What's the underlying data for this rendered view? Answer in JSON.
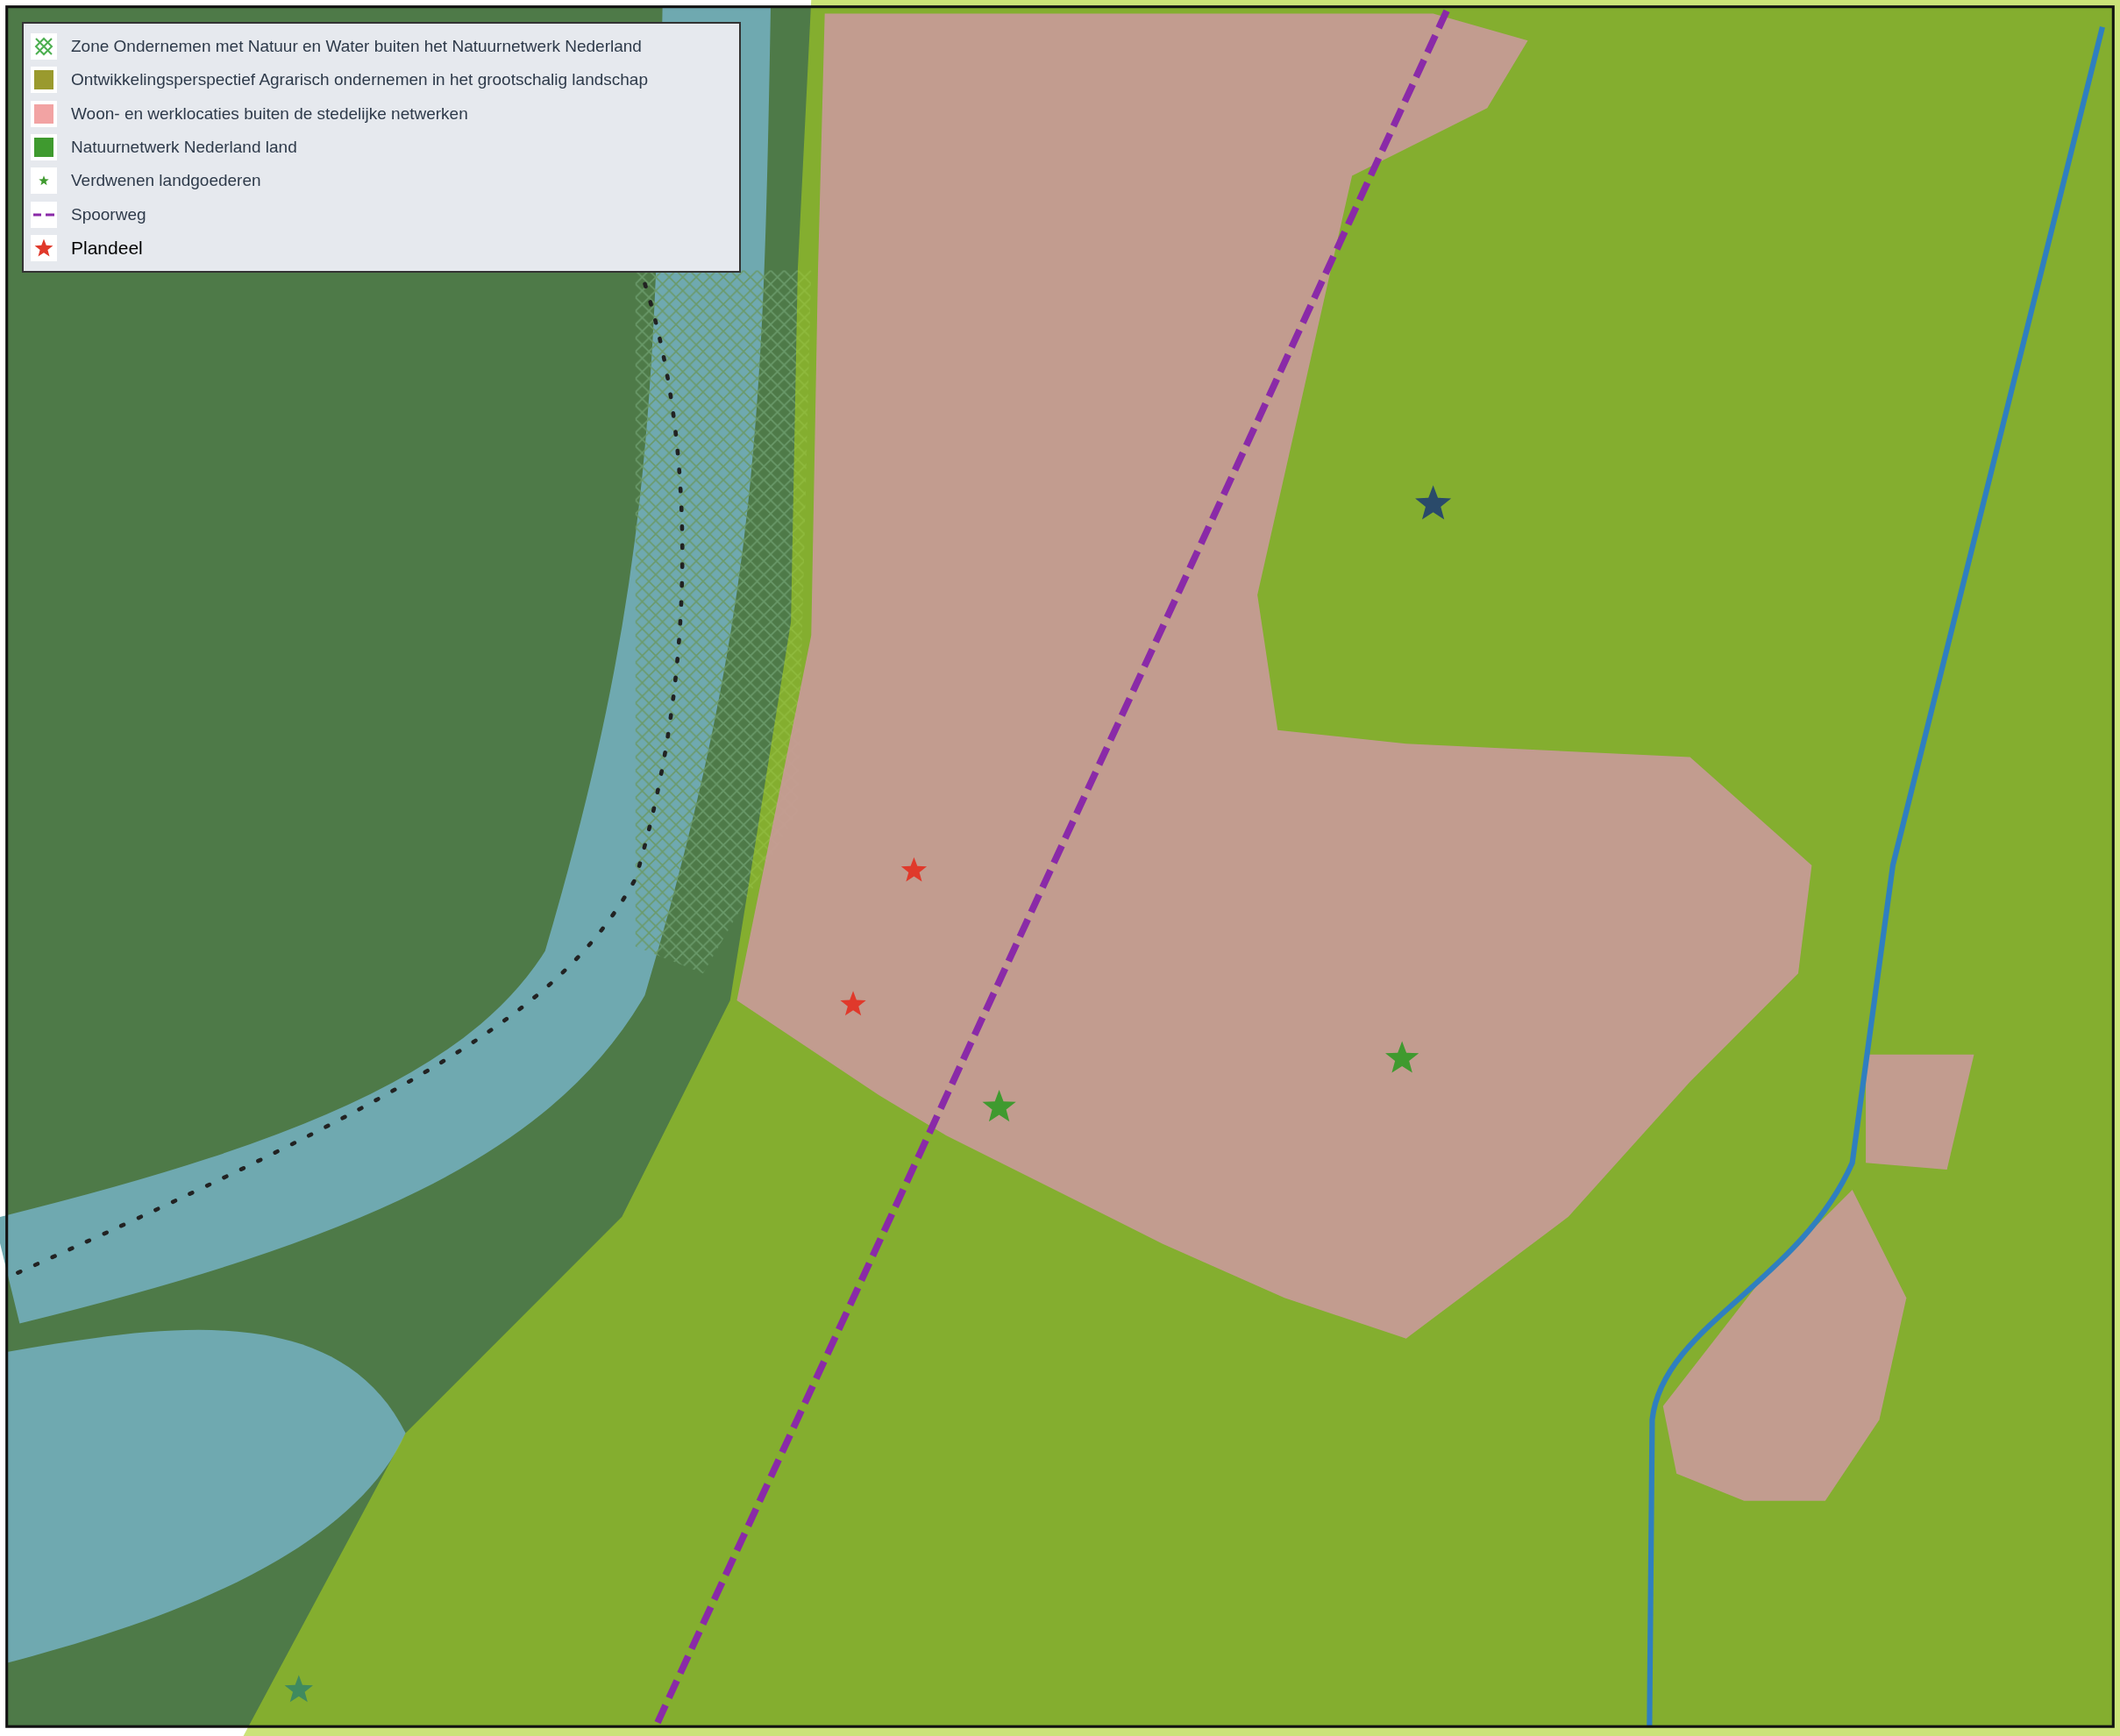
{
  "legend": {
    "items": [
      {
        "kind": "hatch",
        "color": "#4caf50",
        "label": "Zone Ondernemen met Natuur en Water buiten het Natuurnetwerk Nederland"
      },
      {
        "kind": "fill",
        "color": "#9a9a2e",
        "label": "Ontwikkelingsperspectief Agrarisch ondernemen in het grootschalig landschap"
      },
      {
        "kind": "fill",
        "color": "#f2a3a3",
        "label": "Woon- en werklocaties buiten de stedelijke netwerken"
      },
      {
        "kind": "fill",
        "color": "#3f9a2f",
        "label": "Natuurnetwerk Nederland land"
      },
      {
        "kind": "small-star",
        "color": "#3f9a2f",
        "label": "Verdwenen landgoederen"
      },
      {
        "kind": "dash",
        "color": "#8a2aa8",
        "label": "Spoorweg"
      },
      {
        "kind": "star",
        "color": "#e0392b",
        "label": "Plandeel"
      }
    ]
  }
}
